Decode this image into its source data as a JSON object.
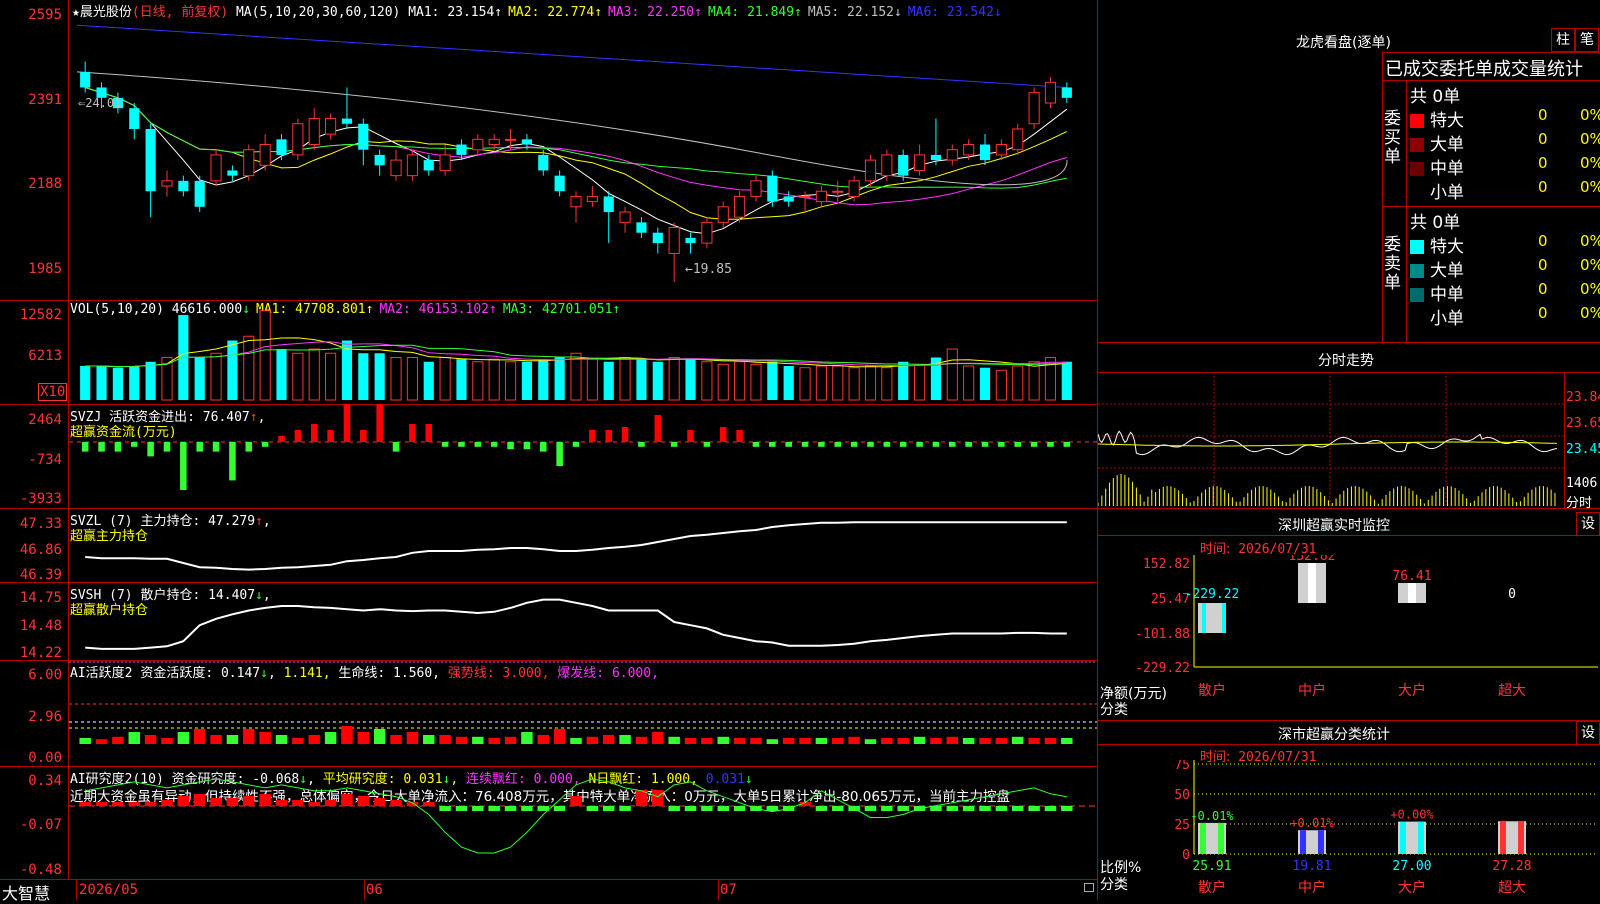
{
  "stock": {
    "name_prefix": "★",
    "name": "晨光股份",
    "period": "(日线, 前复权)",
    "ma_label": "MA(5,10,20,30,60,120)",
    "ma_values": [
      {
        "label": "MA1:",
        "value": "23.154",
        "arrow": "↑",
        "color": "#ffffff"
      },
      {
        "label": "MA2:",
        "value": "22.774",
        "arrow": "↑",
        "color": "#ffff00"
      },
      {
        "label": "MA3:",
        "value": "22.250",
        "arrow": "↑",
        "color": "#ff33ff"
      },
      {
        "label": "MA4:",
        "value": "21.849",
        "arrow": "↑",
        "color": "#33ff33"
      },
      {
        "label": "MA5:",
        "value": "22.152",
        "arrow": "↓",
        "color": "#c0c0c0"
      },
      {
        "label": "MA6:",
        "value": "23.542",
        "arrow": "↓",
        "color": "#3333ff"
      }
    ],
    "price_axis": [
      "2595",
      "2391",
      "2188",
      "1985"
    ],
    "top_marker": "24.01",
    "low_marker": "←19.85"
  },
  "candles": [
    {
      "o": 23.9,
      "c": 23.6,
      "h": 24.1,
      "l": 23.5
    },
    {
      "o": 23.6,
      "c": 23.4,
      "h": 23.7,
      "l": 23.2
    },
    {
      "o": 23.4,
      "c": 23.2,
      "h": 23.5,
      "l": 23.1
    },
    {
      "o": 23.2,
      "c": 22.8,
      "h": 23.3,
      "l": 22.6
    },
    {
      "o": 22.8,
      "c": 21.6,
      "h": 22.9,
      "l": 21.1
    },
    {
      "o": 21.7,
      "c": 21.8,
      "h": 22.0,
      "l": 21.5
    },
    {
      "o": 21.8,
      "c": 21.6,
      "h": 21.9,
      "l": 21.5
    },
    {
      "o": 21.8,
      "c": 21.3,
      "h": 21.9,
      "l": 21.2
    },
    {
      "o": 21.8,
      "c": 22.3,
      "h": 22.4,
      "l": 21.7
    },
    {
      "o": 22.0,
      "c": 21.9,
      "h": 22.1,
      "l": 21.8
    },
    {
      "o": 21.9,
      "c": 22.4,
      "h": 22.5,
      "l": 21.8
    },
    {
      "o": 22.1,
      "c": 22.5,
      "h": 22.7,
      "l": 22.0
    },
    {
      "o": 22.6,
      "c": 22.3,
      "h": 22.7,
      "l": 22.2
    },
    {
      "o": 22.3,
      "c": 22.9,
      "h": 23.0,
      "l": 22.2
    },
    {
      "o": 22.5,
      "c": 23.0,
      "h": 23.2,
      "l": 22.4
    },
    {
      "o": 22.7,
      "c": 23.0,
      "h": 23.1,
      "l": 22.6
    },
    {
      "o": 23.0,
      "c": 22.9,
      "h": 23.6,
      "l": 22.8
    },
    {
      "o": 22.9,
      "c": 22.4,
      "h": 23.0,
      "l": 22.1
    },
    {
      "o": 22.3,
      "c": 22.1,
      "h": 22.4,
      "l": 21.9
    },
    {
      "o": 21.9,
      "c": 22.2,
      "h": 22.4,
      "l": 21.8
    },
    {
      "o": 21.9,
      "c": 22.3,
      "h": 22.4,
      "l": 21.8
    },
    {
      "o": 22.2,
      "c": 22.0,
      "h": 22.3,
      "l": 21.9
    },
    {
      "o": 22.0,
      "c": 22.3,
      "h": 22.5,
      "l": 21.9
    },
    {
      "o": 22.5,
      "c": 22.3,
      "h": 22.6,
      "l": 22.2
    },
    {
      "o": 22.4,
      "c": 22.6,
      "h": 22.7,
      "l": 22.3
    },
    {
      "o": 22.5,
      "c": 22.6,
      "h": 22.7,
      "l": 22.4
    },
    {
      "o": 22.6,
      "c": 22.6,
      "h": 22.8,
      "l": 22.4
    },
    {
      "o": 22.6,
      "c": 22.5,
      "h": 22.7,
      "l": 22.4
    },
    {
      "o": 22.3,
      "c": 22.0,
      "h": 22.4,
      "l": 21.9
    },
    {
      "o": 21.9,
      "c": 21.6,
      "h": 22.0,
      "l": 21.5
    },
    {
      "o": 21.3,
      "c": 21.5,
      "h": 21.6,
      "l": 21.0
    },
    {
      "o": 21.4,
      "c": 21.5,
      "h": 21.7,
      "l": 21.3
    },
    {
      "o": 21.5,
      "c": 21.2,
      "h": 21.6,
      "l": 20.6
    },
    {
      "o": 21.0,
      "c": 21.2,
      "h": 21.3,
      "l": 20.8
    },
    {
      "o": 21.0,
      "c": 20.8,
      "h": 21.1,
      "l": 20.7
    },
    {
      "o": 20.8,
      "c": 20.6,
      "h": 20.9,
      "l": 20.4
    },
    {
      "o": 20.4,
      "c": 20.9,
      "h": 21.0,
      "l": 19.85
    },
    {
      "o": 20.7,
      "c": 20.6,
      "h": 20.8,
      "l": 20.4
    },
    {
      "o": 20.6,
      "c": 21.0,
      "h": 21.1,
      "l": 20.5
    },
    {
      "o": 21.0,
      "c": 21.3,
      "h": 21.4,
      "l": 20.9
    },
    {
      "o": 21.1,
      "c": 21.5,
      "h": 21.6,
      "l": 21.0
    },
    {
      "o": 21.5,
      "c": 21.8,
      "h": 21.9,
      "l": 21.4
    },
    {
      "o": 21.9,
      "c": 21.4,
      "h": 22.0,
      "l": 21.3
    },
    {
      "o": 21.5,
      "c": 21.4,
      "h": 21.6,
      "l": 21.3
    },
    {
      "o": 21.5,
      "c": 21.5,
      "h": 21.6,
      "l": 21.2
    },
    {
      "o": 21.4,
      "c": 21.6,
      "h": 21.7,
      "l": 21.3
    },
    {
      "o": 21.6,
      "c": 21.6,
      "h": 21.8,
      "l": 21.4
    },
    {
      "o": 21.5,
      "c": 21.8,
      "h": 21.9,
      "l": 21.4
    },
    {
      "o": 21.8,
      "c": 22.2,
      "h": 22.3,
      "l": 21.7
    },
    {
      "o": 21.9,
      "c": 22.3,
      "h": 22.4,
      "l": 21.8
    },
    {
      "o": 22.3,
      "c": 21.9,
      "h": 22.4,
      "l": 21.8
    },
    {
      "o": 22.0,
      "c": 22.3,
      "h": 22.5,
      "l": 21.9
    },
    {
      "o": 22.3,
      "c": 22.2,
      "h": 23.0,
      "l": 22.1
    },
    {
      "o": 22.2,
      "c": 22.4,
      "h": 22.5,
      "l": 22.1
    },
    {
      "o": 22.3,
      "c": 22.5,
      "h": 22.6,
      "l": 22.2
    },
    {
      "o": 22.5,
      "c": 22.2,
      "h": 22.7,
      "l": 22.1
    },
    {
      "o": 22.3,
      "c": 22.5,
      "h": 22.6,
      "l": 22.2
    },
    {
      "o": 22.4,
      "c": 22.8,
      "h": 22.9,
      "l": 22.3
    },
    {
      "o": 22.9,
      "c": 23.5,
      "h": 23.6,
      "l": 22.8
    },
    {
      "o": 23.3,
      "c": 23.7,
      "h": 23.8,
      "l": 23.2
    },
    {
      "o": 23.6,
      "c": 23.4,
      "h": 23.7,
      "l": 23.3
    }
  ],
  "volume": {
    "title": "VOL(5,10,20)",
    "value": "46616.000",
    "value_arrow": "↓",
    "ma": [
      {
        "label": "MA1:",
        "value": "47708.801",
        "arrow": "↑",
        "color": "#ffff00"
      },
      {
        "label": "MA2:",
        "value": "46153.102",
        "arrow": "↑",
        "color": "#ff33ff"
      },
      {
        "label": "MA3:",
        "value": "42701.051",
        "arrow": "↑",
        "color": "#33ff33"
      }
    ],
    "axis": [
      "12582",
      "6213"
    ],
    "unit": "X10",
    "bars": [
      0.4,
      0.4,
      0.38,
      0.4,
      0.45,
      0.5,
      1.0,
      0.5,
      0.55,
      0.7,
      0.75,
      1.05,
      0.6,
      0.55,
      0.6,
      0.55,
      0.7,
      0.55,
      0.55,
      0.5,
      0.5,
      0.45,
      0.5,
      0.48,
      0.45,
      0.48,
      0.45,
      0.45,
      0.48,
      0.5,
      0.55,
      0.48,
      0.45,
      0.5,
      0.48,
      0.45,
      0.5,
      0.48,
      0.45,
      0.42,
      0.45,
      0.42,
      0.45,
      0.4,
      0.38,
      0.4,
      0.4,
      0.38,
      0.4,
      0.38,
      0.45,
      0.42,
      0.5,
      0.6,
      0.4,
      0.38,
      0.35,
      0.4,
      0.45,
      0.5,
      0.45
    ]
  },
  "svzj": {
    "title": "SVZJ",
    "label1": "活跃资金进出:",
    "value1": "76.407",
    "arrow1": "↑",
    "label2": "超赢资金流(万元)",
    "axis": [
      "2464",
      "-734",
      "-3933"
    ],
    "bars": [
      -0.2,
      -0.2,
      -0.2,
      -0.1,
      -0.3,
      -0.2,
      -1.0,
      -0.2,
      -0.2,
      -0.8,
      -0.2,
      -0.1,
      0.1,
      0.2,
      0.3,
      0.2,
      0.7,
      0.2,
      0.75,
      -0.2,
      0.3,
      0.3,
      -0.1,
      -0.1,
      -0.1,
      -0.1,
      -0.15,
      -0.15,
      -0.2,
      -0.5,
      -0.1,
      0.2,
      0.2,
      0.25,
      -0.1,
      0.45,
      -0.1,
      0.2,
      -0.1,
      0.25,
      0.2,
      -0.1,
      -0.1,
      -0.1,
      -0.1,
      -0.1,
      -0.1,
      -0.1,
      -0.1,
      -0.1,
      -0.1,
      -0.1,
      -0.1,
      -0.1,
      -0.1,
      -0.1,
      -0.1,
      -0.1,
      -0.1,
      -0.1,
      -0.1
    ]
  },
  "svzl": {
    "title": "SVZL (7)",
    "label1": "主力持仓:",
    "value1": "47.279",
    "arrow1": "↑",
    "label2": "超赢主力持仓",
    "axis": [
      "47.33",
      "46.86",
      "46.39"
    ],
    "line": [
      0.35,
      0.33,
      0.33,
      0.33,
      0.32,
      0.32,
      0.25,
      0.18,
      0.17,
      0.15,
      0.14,
      0.15,
      0.17,
      0.18,
      0.2,
      0.22,
      0.28,
      0.3,
      0.33,
      0.35,
      0.42,
      0.45,
      0.45,
      0.45,
      0.47,
      0.48,
      0.5,
      0.5,
      0.48,
      0.45,
      0.45,
      0.47,
      0.5,
      0.52,
      0.55,
      0.6,
      0.65,
      0.7,
      0.72,
      0.75,
      0.78,
      0.8,
      0.85,
      0.88,
      0.9,
      0.92,
      0.92,
      0.93,
      0.93,
      0.93,
      0.93,
      0.93,
      0.93,
      0.93,
      0.93,
      0.93,
      0.93,
      0.93,
      0.93,
      0.93,
      0.93
    ]
  },
  "svsh": {
    "title": "SVSH (7)",
    "label1": "散户持仓:",
    "value1": "14.407",
    "arrow1": "↓",
    "label2": "超赢散户持仓",
    "axis": [
      "14.75",
      "14.48",
      "14.22"
    ],
    "line": [
      0.1,
      0.08,
      0.08,
      0.08,
      0.1,
      0.12,
      0.2,
      0.45,
      0.55,
      0.62,
      0.68,
      0.72,
      0.75,
      0.75,
      0.73,
      0.72,
      0.7,
      0.68,
      0.7,
      0.68,
      0.67,
      0.68,
      0.68,
      0.66,
      0.64,
      0.66,
      0.72,
      0.8,
      0.85,
      0.85,
      0.8,
      0.75,
      0.68,
      0.68,
      0.68,
      0.68,
      0.5,
      0.45,
      0.4,
      0.3,
      0.25,
      0.2,
      0.18,
      0.13,
      0.13,
      0.13,
      0.14,
      0.16,
      0.2,
      0.22,
      0.25,
      0.28,
      0.3,
      0.32,
      0.32,
      0.32,
      0.32,
      0.33,
      0.33,
      0.32,
      0.32
    ]
  },
  "ai_activity": {
    "title": "AI活跃度2",
    "label1": "资金活跃度:",
    "value1": "0.147",
    "arrow1": "↓",
    "value2": "1.141,",
    "label3": "生命线:",
    "value3": "1.560,",
    "label4": "强势线:",
    "value4": "3.000,",
    "label5": "爆发线:",
    "value5": "6.000,",
    "axis": [
      "6.00",
      "2.96",
      "0.00"
    ],
    "bars": [
      0.1,
      0.08,
      0.12,
      0.2,
      0.15,
      0.1,
      0.2,
      0.25,
      0.15,
      0.15,
      0.25,
      0.2,
      0.15,
      0.1,
      0.15,
      0.2,
      0.3,
      0.2,
      0.25,
      0.15,
      0.2,
      0.15,
      0.15,
      0.12,
      0.12,
      0.1,
      0.12,
      0.2,
      0.15,
      0.25,
      0.1,
      0.12,
      0.15,
      0.15,
      0.12,
      0.2,
      0.12,
      0.1,
      0.1,
      0.12,
      0.1,
      0.1,
      0.08,
      0.1,
      0.1,
      0.1,
      0.1,
      0.12,
      0.08,
      0.1,
      0.1,
      0.12,
      0.1,
      0.12,
      0.1,
      0.1,
      0.1,
      0.12,
      0.1,
      0.1,
      0.1
    ]
  },
  "ai_research": {
    "title": "AI研究度2(10)",
    "label1": "资金研究度:",
    "value1": "-0.068",
    "arrow1": "↓",
    "label2": "平均研究度:",
    "value2": "0.031",
    "arrow2": "↓",
    "label3": "连续飘红:",
    "value3": "0.000,",
    "label4": "N日飘红:",
    "value4": "1.000,",
    "value5": "0.031",
    "arrow5": "↓",
    "note": "近期大资金虽有异动，但持续性不强，总体偏空，今日大单净流入：76.408万元，其中特大单净流入：0万元，大单5日累计净出-80.065万元，当前主力控盘",
    "axis": [
      "0.34",
      "-0.07",
      "-0.48"
    ],
    "bars": [
      0.1,
      0.1,
      0.1,
      0.1,
      0.1,
      0.15,
      0.25,
      0.3,
      0.2,
      0.2,
      0.25,
      0.3,
      0.15,
      0.15,
      0.1,
      0.15,
      0.3,
      0.25,
      0.2,
      0.15,
      0.1,
      0.1,
      -0.1,
      -0.1,
      -0.1,
      -0.1,
      -0.1,
      -0.1,
      -0.1,
      -0.1,
      0.25,
      -0.1,
      -0.1,
      -0.1,
      0.4,
      0.4,
      -0.1,
      -0.1,
      -0.1,
      -0.1,
      -0.1,
      -0.1,
      -0.1,
      -0.1,
      0.1,
      -0.1,
      -0.1,
      -0.1,
      -0.1,
      -0.1,
      -0.1,
      -0.1,
      -0.1,
      -0.1,
      -0.1,
      -0.1,
      -0.1,
      -0.1,
      -0.1,
      -0.1,
      -0.1
    ],
    "line": [
      0.1,
      0.15,
      0.2,
      0.25,
      0.2,
      0.15,
      0.2,
      0.25,
      0.3,
      0.25,
      0.2,
      0.15,
      0.2,
      0.15,
      0.1,
      0.1,
      0.15,
      0.1,
      0.05,
      0.0,
      -0.1,
      -0.3,
      -0.6,
      -0.85,
      -0.95,
      -0.95,
      -0.85,
      -0.6,
      -0.3,
      -0.05,
      0.2,
      0.3,
      0.25,
      0.15,
      0.1,
      0.0,
      0.2,
      0.25,
      0.1,
      0.0,
      -0.1,
      -0.2,
      -0.25,
      -0.2,
      -0.1,
      0.1,
      -0.05,
      -0.2,
      -0.35,
      -0.35,
      -0.3,
      -0.2,
      -0.15,
      -0.1,
      -0.05,
      0.0,
      0.05,
      0.1,
      0.15,
      0.05,
      0.0
    ]
  },
  "bottom_bar": {
    "brand": "大智慧",
    "dates": [
      "2026/05",
      "06",
      "07"
    ]
  },
  "longhu": {
    "title": "龙虎看盘(逐单)",
    "btn1": "柱",
    "btn2": "笔",
    "header": "已成交委托单成交量统计",
    "buy_label": "委买单",
    "sell_label": "委卖单",
    "buy_total": "共 0单",
    "sell_total": "共 0单",
    "buy_rows": [
      {
        "name": "特大",
        "count": "0",
        "pct": "0%",
        "color": "#ff0000"
      },
      {
        "name": "大单",
        "count": "0",
        "pct": "0%",
        "color": "#8b0000"
      },
      {
        "name": "中单",
        "count": "0",
        "pct": "0%",
        "color": "#6b0000"
      },
      {
        "name": "小单",
        "count": "0",
        "pct": "0%",
        "color": "#000000"
      }
    ],
    "sell_rows": [
      {
        "name": "特大",
        "count": "0",
        "pct": "0%",
        "color": "#00ffff"
      },
      {
        "name": "大单",
        "count": "0",
        "pct": "0%",
        "color": "#008b8b"
      },
      {
        "name": "中单",
        "count": "0",
        "pct": "0%",
        "color": "#006b6b"
      },
      {
        "name": "小单",
        "count": "0",
        "pct": "0%",
        "color": "#000000"
      }
    ]
  },
  "intraday": {
    "title": "分时走势",
    "axis": [
      "23.84",
      "23.65",
      "23.45"
    ],
    "vol_label": "1406",
    "vol_unit": "分时"
  },
  "realtime": {
    "title": "深圳超赢实时监控",
    "btn": "设",
    "time_label": "时间:",
    "time_value": "2026/07/31",
    "axis": [
      "152.82",
      "25.47",
      "-101.88",
      "-229.22"
    ],
    "ylabel": "净额(万元)",
    "xlabel": "分类",
    "bars": [
      {
        "cat": "散户",
        "value": "-229.22"
      },
      {
        "cat": "中户",
        "value": "152.82"
      },
      {
        "cat": "大户",
        "value": "76.41"
      },
      {
        "cat": "超大",
        "value": "0"
      }
    ]
  },
  "category": {
    "title": "深市超赢分类统计",
    "btn": "设",
    "time_label": "时间:",
    "time_value": "2026/07/31",
    "axis": [
      "75",
      "50",
      "25",
      "0"
    ],
    "ylabel": "比例%",
    "xlabel": "分类",
    "bars": [
      {
        "cat": "散户",
        "value": "25.91",
        "change": "-0.01%",
        "color": "#33ff33"
      },
      {
        "cat": "中户",
        "value": "19.81",
        "change": "+0.01%",
        "color": "#3333ff"
      },
      {
        "cat": "大户",
        "value": "27.00",
        "change": "+0.00%",
        "color": "#00ffff"
      },
      {
        "cat": "超大",
        "value": "27.28",
        "change": "",
        "color": "#ff3333"
      }
    ]
  }
}
